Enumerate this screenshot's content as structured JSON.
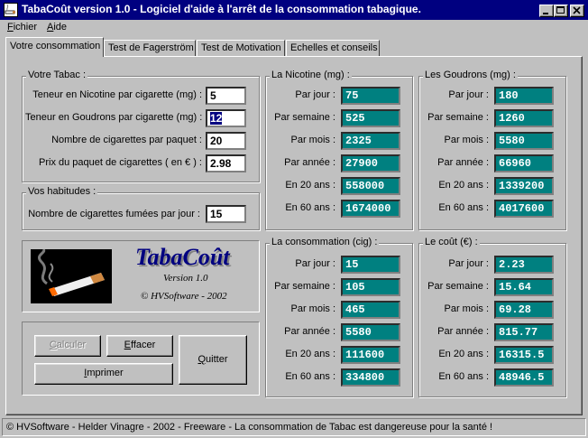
{
  "window": {
    "title": "TabaCoût version 1.0 - Logiciel d'aide à l'arrêt de la consommation tabagique."
  },
  "menu": [
    {
      "label": "Fichier"
    },
    {
      "label": "Aide"
    }
  ],
  "tabs": [
    {
      "label": "Votre consommation",
      "active": true
    },
    {
      "label": "Test de Fagerström"
    },
    {
      "label": "Test de Motivation"
    },
    {
      "label": "Echelles et conseils"
    }
  ],
  "votre_tabac": {
    "title": "Votre Tabac :",
    "fields": [
      {
        "label": "Teneur en Nicotine par cigarette (mg) :",
        "value": "5"
      },
      {
        "label": "Teneur en Goudrons par cigarette (mg) :",
        "value": "12"
      },
      {
        "label": "Nombre de cigarettes par paquet :",
        "value": "20"
      },
      {
        "label": "Prix du paquet de cigarettes ( en € ) :",
        "value": "2.98"
      }
    ]
  },
  "habitudes": {
    "title": "Vos habitudes :",
    "label": "Nombre de cigarettes fumées par jour :",
    "value": "15"
  },
  "logo": {
    "title": "TabaCoût",
    "version": "Version 1.0",
    "copyright": "© HVSoftware - 2002"
  },
  "buttons": {
    "calculer": "Calculer",
    "effacer": "Effacer",
    "imprimer": "Imprimer",
    "quitter": "Quitter"
  },
  "period_labels": [
    "Par jour :",
    "Par semaine :",
    "Par mois :",
    "Par année :",
    "En 20 ans :",
    "En 60 ans :"
  ],
  "nicotine": {
    "title": "La Nicotine (mg) :",
    "values": [
      "75",
      "525",
      "2325",
      "27900",
      "558000",
      "1674000"
    ]
  },
  "goudrons": {
    "title": "Les Goudrons (mg) :",
    "values": [
      "180",
      "1260",
      "5580",
      "66960",
      "1339200",
      "4017600"
    ]
  },
  "consommation": {
    "title": "La consommation (cig) :",
    "values": [
      "15",
      "105",
      "465",
      "5580",
      "111600",
      "334800"
    ]
  },
  "cout": {
    "title": "Le coût (€) :",
    "values": [
      "2.23",
      "15.64",
      "69.28",
      "815.77",
      "16315.5",
      "48946.5"
    ]
  },
  "status": "© HVSoftware - Helder Vinagre - 2002 - Freeware - La consommation de Tabac est dangereuse pour la santé !",
  "colors": {
    "title_bar": "#000080",
    "value_box": "#008080",
    "window": "#c0c0c0"
  }
}
